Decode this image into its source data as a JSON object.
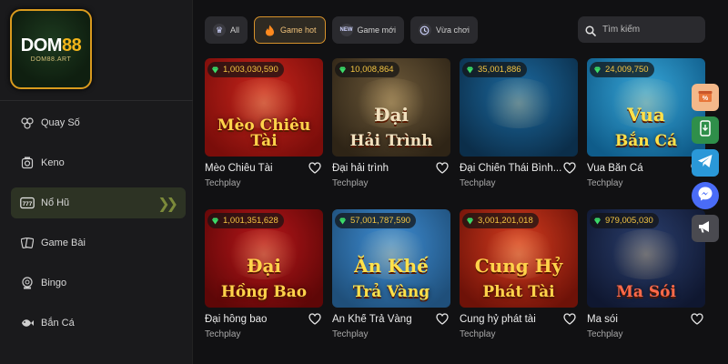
{
  "brand": {
    "name_main": "DOM",
    "name_num": "88",
    "sub": "DOM88.ART"
  },
  "sidebar": {
    "items": [
      {
        "label": "Quay Số",
        "icon": "lottery-balls-icon",
        "active": false
      },
      {
        "label": "Keno",
        "icon": "keno-icon",
        "active": false
      },
      {
        "label": "Nổ Hũ",
        "icon": "slot-777-icon",
        "active": true
      },
      {
        "label": "Game Bài",
        "icon": "cards-icon",
        "active": false
      },
      {
        "label": "Bingo",
        "icon": "bingo-icon",
        "active": false
      },
      {
        "label": "Bắn Cá",
        "icon": "fish-icon",
        "active": false
      }
    ]
  },
  "filters": {
    "tabs": [
      {
        "label": "All",
        "icon": "crown-icon",
        "active": false
      },
      {
        "label": "Game hot",
        "icon": "fire-icon",
        "active": true
      },
      {
        "label": "Game mới",
        "icon": "new-icon",
        "active": false
      },
      {
        "label": "Vừa chơi",
        "icon": "history-icon",
        "active": false
      }
    ],
    "search_placeholder": "Tìm kiếm"
  },
  "games": [
    {
      "jackpot": "1,003,030,590",
      "name": "Mèo Chiêu Tài",
      "provider": "Techplay",
      "art_title": "Mèo Chiêu Tài",
      "art_sub": "",
      "bg": [
        "#c8251c",
        "#7a0d0a"
      ],
      "title_color": "#ffd34a"
    },
    {
      "jackpot": "10,008,864",
      "name": "Đại hải trình",
      "provider": "Techplay",
      "art_title": "Đại",
      "art_sub": "Hải Trình",
      "bg": [
        "#6e5a3a",
        "#2e2416"
      ],
      "title_color": "#f1e1bf"
    },
    {
      "jackpot": "35,001,886",
      "name": "Đại Chiến Thái Bình...",
      "provider": "Techplay",
      "art_title": "",
      "art_sub": "",
      "bg": [
        "#1c6aa0",
        "#0b2e4a"
      ],
      "title_color": "#ffd34a"
    },
    {
      "jackpot": "24,009,750",
      "name": "Vua Bắn Cá",
      "provider": "Techplay",
      "art_title": "Vua",
      "art_sub": "Bắn Cá",
      "bg": [
        "#37a7d9",
        "#0f5c8a"
      ],
      "title_color": "#ffe14a"
    },
    {
      "jackpot": "1,001,351,628",
      "name": "Đại hồng bao",
      "provider": "Techplay",
      "art_title": "Đại",
      "art_sub": "Hồng Bao",
      "bg": [
        "#b8161a",
        "#5e0707"
      ],
      "title_color": "#ffd34a"
    },
    {
      "jackpot": "57,001,787,590",
      "name": "Ăn Khế Trả Vàng",
      "provider": "Techplay",
      "art_title": "Ăn Khế",
      "art_sub": "Trả Vàng",
      "bg": [
        "#3f8fd6",
        "#1f4f7a"
      ],
      "title_color": "#ffe14a"
    },
    {
      "jackpot": "3,001,201,018",
      "name": "Cung hỷ phát tài",
      "provider": "Techplay",
      "art_title": "Cung Hỷ",
      "art_sub": "Phát Tài",
      "bg": [
        "#d63c1f",
        "#6e1208"
      ],
      "title_color": "#ffd34a"
    },
    {
      "jackpot": "979,005,030",
      "name": "Ma sói",
      "provider": "Techplay",
      "art_title": "Ma Sói",
      "art_sub": "",
      "bg": [
        "#2b3f6e",
        "#0f1730"
      ],
      "title_color": "#ff6a4a"
    }
  ],
  "floating_buttons": [
    {
      "name": "promo-icon",
      "color": "#f0a06a"
    },
    {
      "name": "app-download-icon",
      "color": "#3aa356"
    },
    {
      "name": "telegram-icon",
      "color": "#2a98d8"
    },
    {
      "name": "messenger-icon",
      "color": "#4a6cf7"
    },
    {
      "name": "megaphone-icon",
      "color": "#5a5a5e"
    }
  ],
  "colors": {
    "accent": "#d6912b",
    "jackpot": "#f4c542",
    "active_nav": "#2d3324"
  }
}
